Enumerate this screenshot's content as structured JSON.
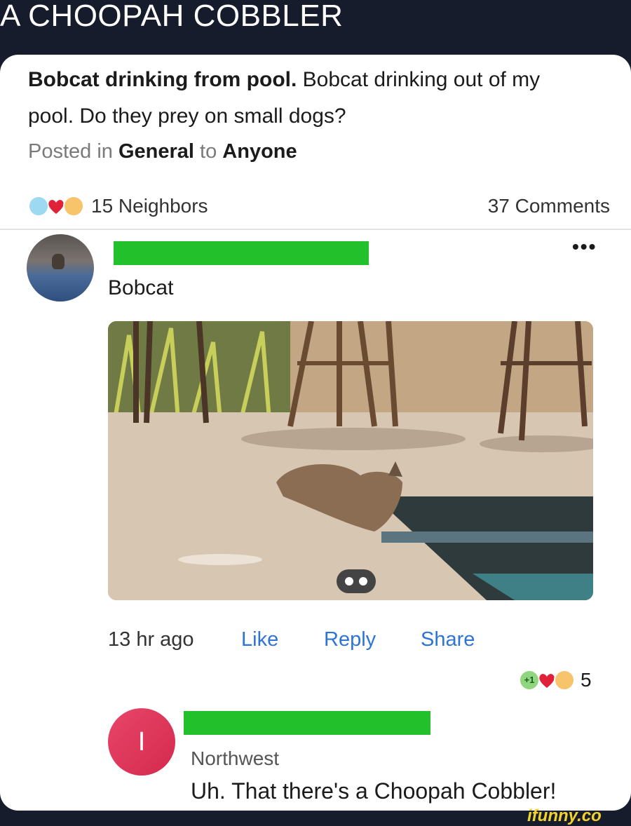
{
  "meme_title": "A CHOOPAH COBBLER",
  "post": {
    "title_bold": "Bobcat drinking from pool.",
    "title_rest": " Bobcat drinking out of my pool. Do they prey on small dogs?",
    "posted_prefix": "Posted in ",
    "category": "General",
    "to_word": " to ",
    "audience": "Anyone",
    "reaction_count": "15 Neighbors",
    "comment_count": "37 Comments"
  },
  "comment1": {
    "author": "Bobcat",
    "time": "13 hr ago",
    "like": "Like",
    "reply": "Reply",
    "share": "Share",
    "more_label": "•••",
    "reaction_count": "5"
  },
  "comment2": {
    "avatar_letter": "I",
    "author": "Northwest",
    "text": "Uh. That there's a Choopah Cobbler!"
  },
  "watermark": "ifunny.co",
  "colors": {
    "link": "#2e74d6",
    "redaction": "#22c02a",
    "avatar_pink": "#e23a5e"
  },
  "icons": [
    "tear-emoji-icon",
    "heart-icon",
    "wow-emoji-icon",
    "plus-one-icon",
    "more-icon",
    "gallery-indicator-icon"
  ]
}
